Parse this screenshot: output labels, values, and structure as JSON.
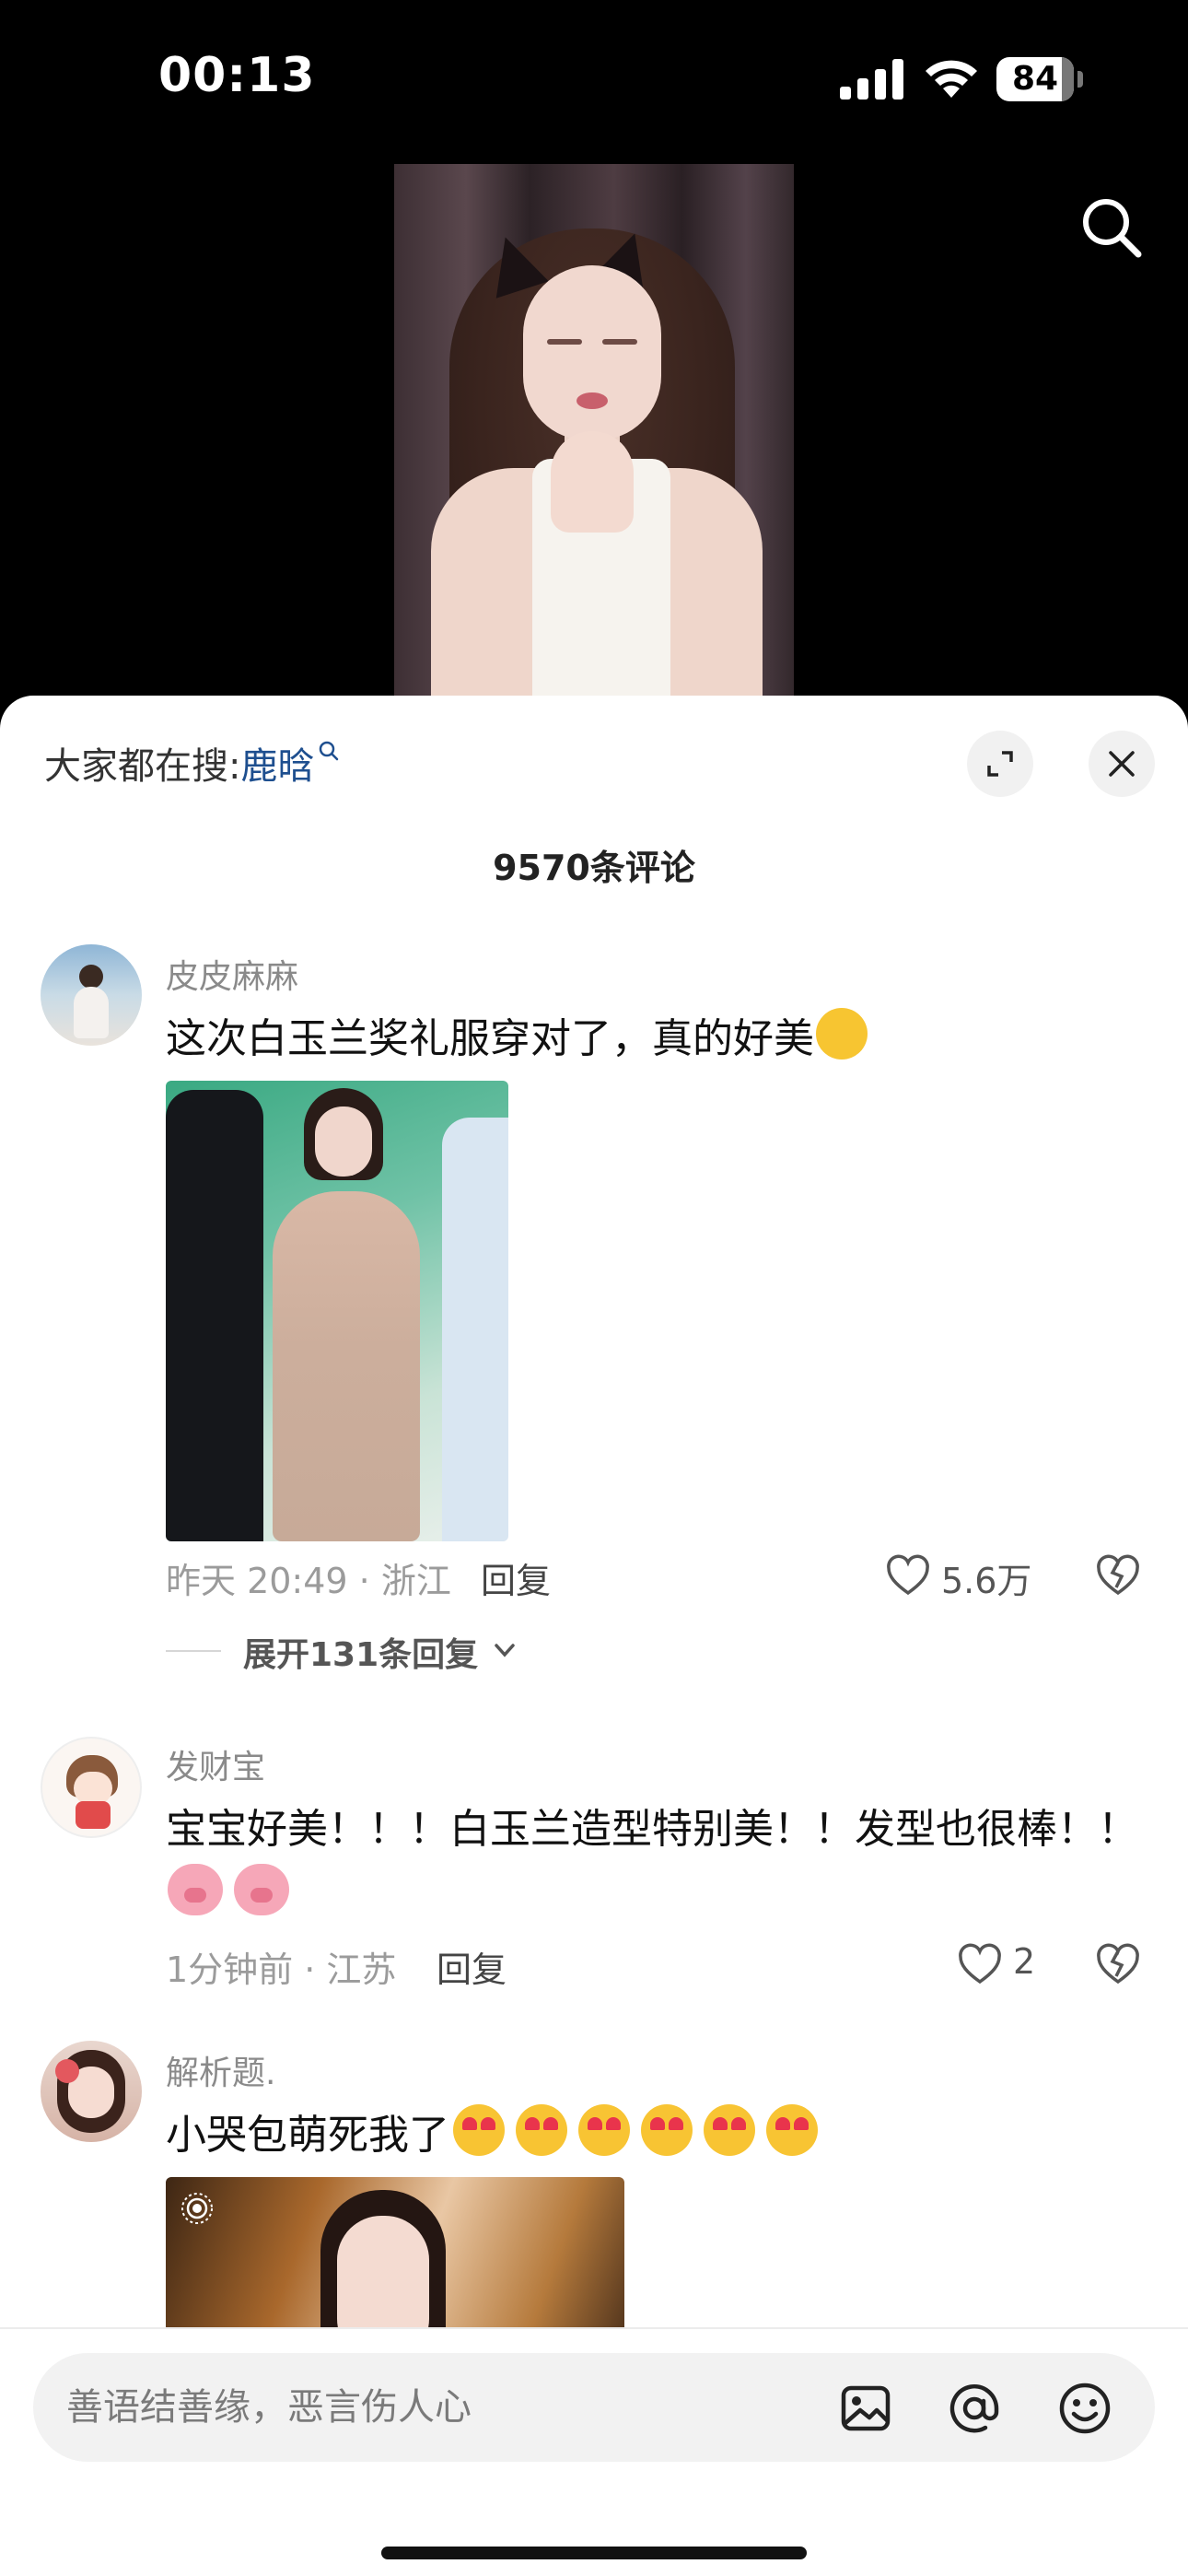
{
  "status_bar": {
    "time": "00:13",
    "battery_level": "84",
    "battery_fraction": 0.84
  },
  "video": {
    "description_icon": "search-icon"
  },
  "sheet": {
    "trending_prefix": "大家都在搜:",
    "trending_term": "鹿晗",
    "comment_count": "9570条评论"
  },
  "comments": [
    {
      "username": "皮皮麻麻",
      "text": "这次白玉兰奖礼服穿对了，真的好美",
      "emoji": "thinking-face-emoji",
      "time_location": "昨天 20:49 · 浙江",
      "reply_label": "回复",
      "likes": "5.6万",
      "expand_replies": "展开131条回复"
    },
    {
      "username": "发财宝",
      "text": "宝宝好美！！！白玉兰造型特别美！！发型也很棒！！",
      "emoji": "pig-face-emoji",
      "time_location": "1分钟前 · 江苏",
      "reply_label": "回复",
      "likes": "2"
    },
    {
      "username": "解析题.",
      "text": "小哭包萌死我了",
      "emoji": "heart-eyes-emoji"
    }
  ],
  "input": {
    "placeholder": "善语结善缘，恶言伤人心"
  },
  "colors": {
    "link_blue": "#1e4f8f",
    "sheet_bg": "#ffffff",
    "top_bg": "#000000"
  }
}
